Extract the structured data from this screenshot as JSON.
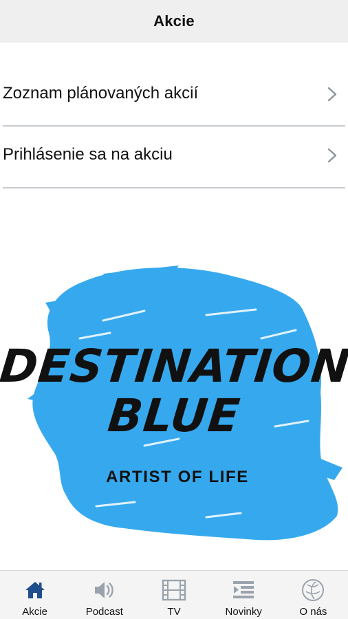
{
  "header": {
    "title": "Akcie"
  },
  "menu": {
    "items": [
      {
        "label": "Zoznam plánovaných akcií",
        "icon": "chevron-right-icon"
      },
      {
        "label": "Prihlásenie sa na akciu",
        "icon": "chevron-right-icon"
      }
    ]
  },
  "logo": {
    "line1": "DESTINATION",
    "line2": "BLUE",
    "tagline": "ARTIST OF LIFE",
    "brush_color": "#36A9EE"
  },
  "tabbar": {
    "active_color": "#1F4E8C",
    "inactive_color": "#9AA3AD",
    "items": [
      {
        "label": "Akcie",
        "icon": "home-icon",
        "active": true
      },
      {
        "label": "Podcast",
        "icon": "speaker-icon",
        "active": false
      },
      {
        "label": "TV",
        "icon": "film-icon",
        "active": false
      },
      {
        "label": "Novinky",
        "icon": "news-list-icon",
        "active": false
      },
      {
        "label": "O nás",
        "icon": "globe-icon",
        "active": false
      }
    ]
  }
}
